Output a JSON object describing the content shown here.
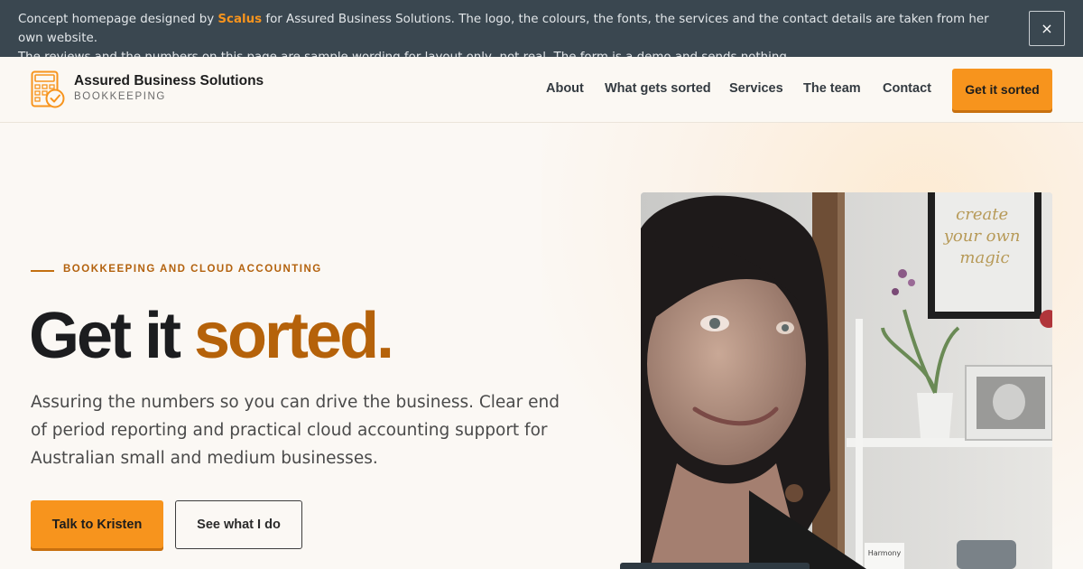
{
  "notice": {
    "line1_before": "Concept homepage designed by ",
    "brand": "Scalus",
    "line1_after": " for Assured Business Solutions. The logo, the colours, the fonts, the services and the contact details are taken from her own website.",
    "line2": "The reviews and the numbers on this page are sample wording for layout only, not real. The form is a demo and sends nothing.",
    "close_label": "×"
  },
  "header": {
    "logo_name": "Assured Business Solutions",
    "logo_sub": "BOOKKEEPING",
    "nav": [
      "About",
      "What gets sorted",
      "Services",
      "The team",
      "Contact"
    ],
    "cta": "Get it sorted"
  },
  "hero": {
    "eyebrow": "BOOKKEEPING AND CLOUD ACCOUNTING",
    "headline_plain": "Get it ",
    "headline_accent": "sorted.",
    "lede": "Assuring the numbers so you can drive the business. Clear end of period reporting and practical cloud accounting support for Australian small and medium businesses.",
    "primary_button": "Talk to Kristen",
    "secondary_button": "See what I do"
  },
  "photo": {
    "wall_art_text": "create your own magic",
    "jar_label": "Harmony"
  },
  "colors": {
    "accent": "#f7941d",
    "accent_dark": "#b5620a",
    "banner_bg": "#3a4750",
    "page_bg": "#fbf8f4"
  }
}
